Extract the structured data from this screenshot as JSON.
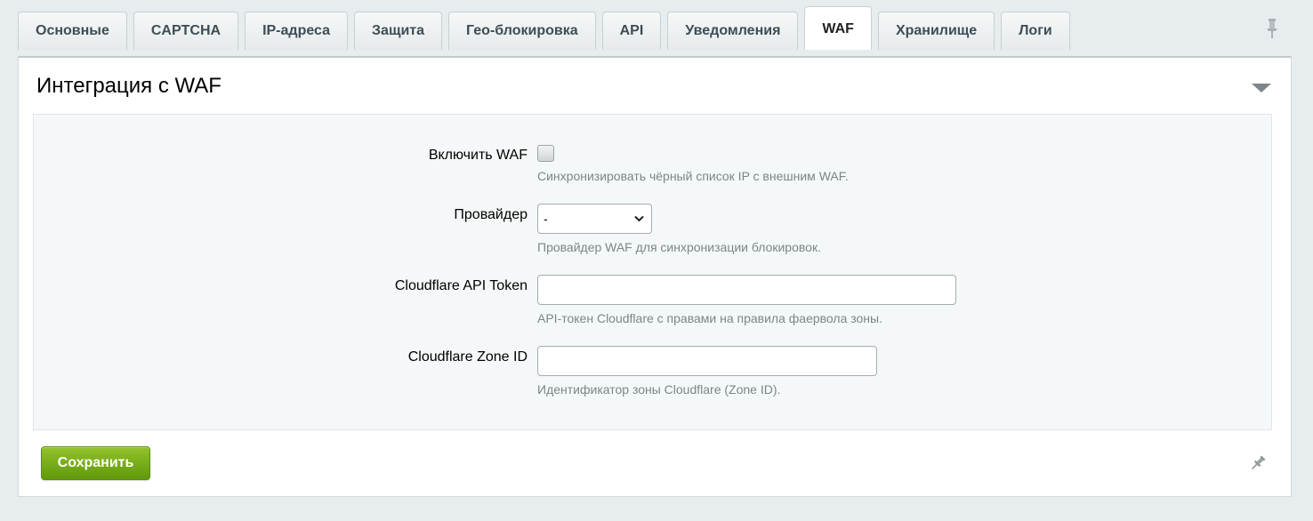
{
  "tabs": [
    {
      "label": "Основные"
    },
    {
      "label": "CAPTCHA"
    },
    {
      "label": "IP-адреса"
    },
    {
      "label": "Защита"
    },
    {
      "label": "Гео-блокировка"
    },
    {
      "label": "API"
    },
    {
      "label": "Уведомления"
    },
    {
      "label": "WAF",
      "active": true
    },
    {
      "label": "Хранилище"
    },
    {
      "label": "Логи"
    }
  ],
  "section": {
    "title": "Интеграция с WAF"
  },
  "form": {
    "enable_waf": {
      "label": "Включить WAF",
      "checked": false,
      "hint": "Синхронизировать чёрный список IP с внешним WAF."
    },
    "provider": {
      "label": "Провайдер",
      "value": "-",
      "hint": "Провайдер WAF для синхронизации блокировок."
    },
    "api_token": {
      "label": "Cloudflare API Token",
      "value": "",
      "hint": "API-токен Cloudflare с правами на правила фаервола зоны."
    },
    "zone_id": {
      "label": "Cloudflare Zone ID",
      "value": "",
      "hint": "Идентификатор зоны Cloudflare (Zone ID)."
    }
  },
  "actions": {
    "save_label": "Сохранить"
  },
  "icons": {
    "pin": "pin-icon",
    "collapse": "triangle-down-icon"
  },
  "colors": {
    "save_button": "#6fa616",
    "background": "#e7ecee",
    "form_area": "#f5f8f8"
  }
}
